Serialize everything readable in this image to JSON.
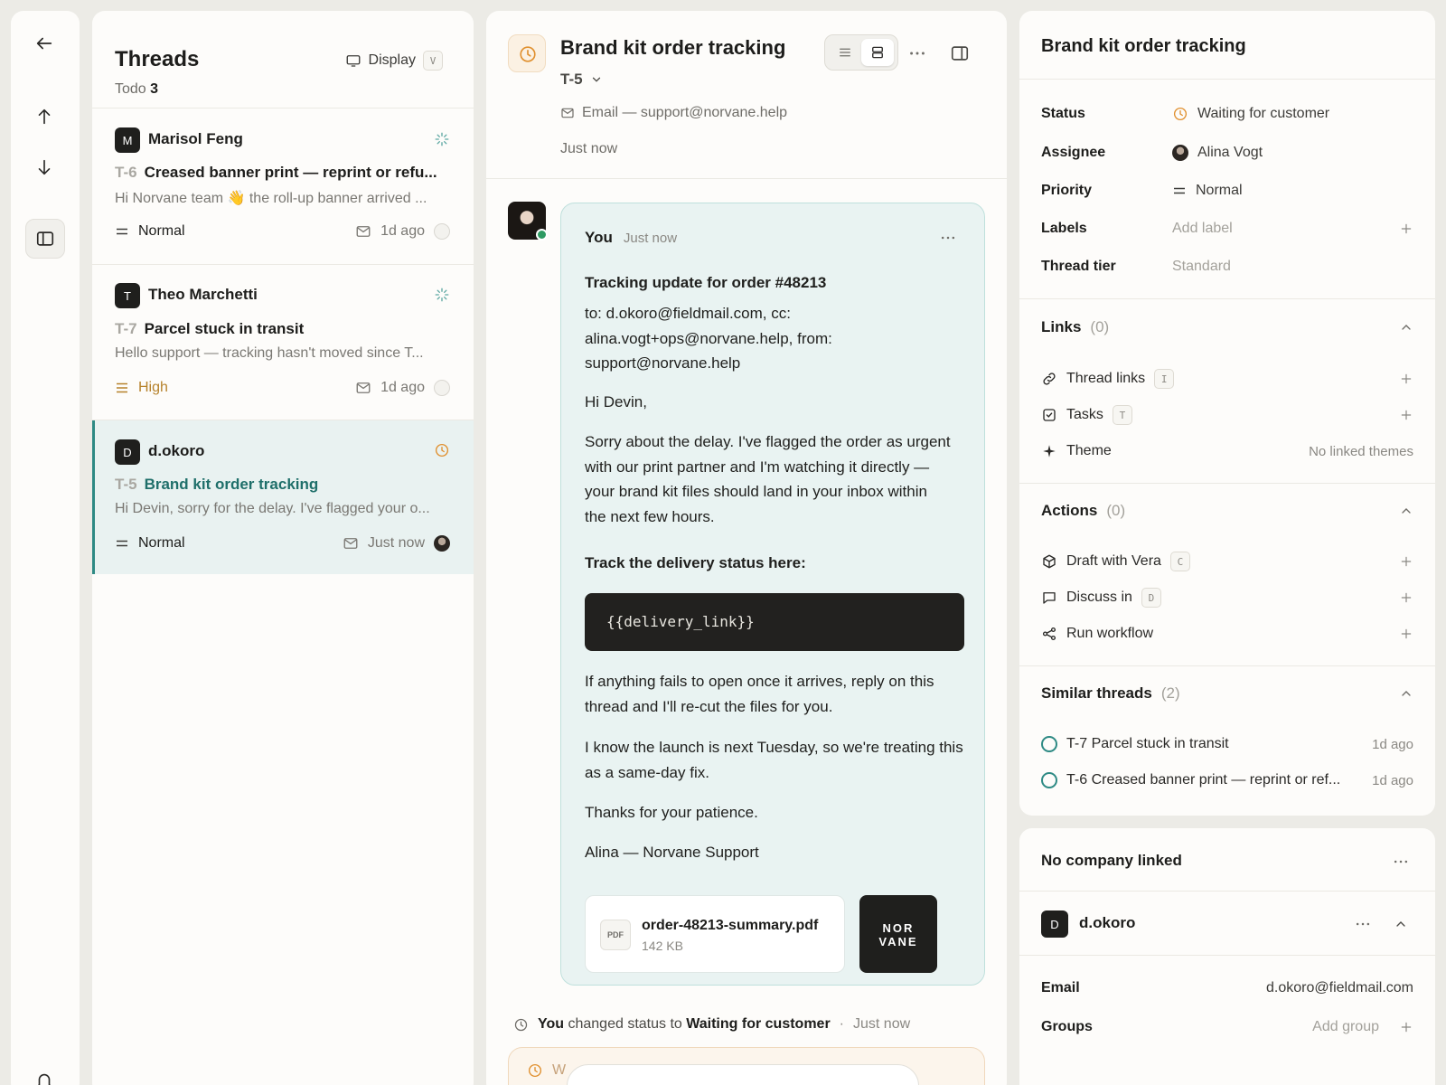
{
  "threads": {
    "title": "Threads",
    "filter_label": "Todo",
    "filter_count": "3",
    "display_label": "Display",
    "display_shortcut": "V",
    "items": [
      {
        "initial": "M",
        "name": "Marisol Feng",
        "id": "T-6",
        "subject": "Creased banner print — reprint or refu...",
        "preview": "Hi Norvane team 👋 the roll-up banner arrived ...",
        "priority": "Normal",
        "time": "1d ago"
      },
      {
        "initial": "T",
        "name": "Theo Marchetti",
        "id": "T-7",
        "subject": "Parcel stuck in transit",
        "preview": "Hello support — tracking hasn't moved since T...",
        "priority": "High",
        "time": "1d ago"
      },
      {
        "initial": "D",
        "name": "d.okoro",
        "id": "T-5",
        "subject": "Brand kit order tracking",
        "preview": "Hi Devin, sorry for the delay. I've flagged your o...",
        "priority": "Normal",
        "time": "Just now"
      }
    ]
  },
  "conversation": {
    "title": "Brand kit order tracking",
    "thread_id": "T-5",
    "channel": "Email — support@norvane.help",
    "updated": "Just now",
    "message": {
      "author": "You",
      "time": "Just now",
      "subject": "Tracking update for order #48213",
      "recipients": "to: d.okoro@fieldmail.com, cc: alina.vogt+ops@norvane.help, from: support@norvane.help",
      "greeting": "Hi Devin,",
      "p1": "Sorry about the delay. I've flagged the order as urgent with our print partner and I'm watching it directly — your brand kit files should land in your inbox within the next few hours.",
      "track_heading": "Track the delivery status here:",
      "code": "{{delivery_link}}",
      "p2": "If anything fails to open once it arrives, reply on this thread and I'll re-cut the files for you.",
      "p3": "I know the launch is next Tuesday, so we're treating this as a same-day fix.",
      "p4": "Thanks for your patience.",
      "signature": "Alina — Norvane Support",
      "attachment": {
        "badge": "PDF",
        "name": "order-48213-summary.pdf",
        "size": "142 KB"
      },
      "logo_line1": "NOR",
      "logo_line2": "VANE"
    },
    "event": {
      "actor": "You",
      "verb": "changed status to",
      "status": "Waiting for customer",
      "sep": "·",
      "time": "Just now"
    },
    "compose_hint": "W"
  },
  "details": {
    "title": "Brand kit order tracking",
    "props": {
      "status_k": "Status",
      "status_v": "Waiting for customer",
      "assignee_k": "Assignee",
      "assignee_v": "Alina Vogt",
      "priority_k": "Priority",
      "priority_v": "Normal",
      "labels_k": "Labels",
      "labels_v": "Add label",
      "tier_k": "Thread tier",
      "tier_v": "Standard"
    },
    "links": {
      "title": "Links",
      "count": "(0)",
      "items": [
        {
          "label": "Thread links",
          "key": "I"
        },
        {
          "label": "Tasks",
          "key": "T"
        },
        {
          "label": "Theme",
          "value": "No linked themes"
        }
      ]
    },
    "actions": {
      "title": "Actions",
      "count": "(0)",
      "items": [
        {
          "label": "Draft with Vera",
          "key": "C"
        },
        {
          "label": "Discuss in",
          "key": "D"
        },
        {
          "label": "Run workflow"
        }
      ]
    },
    "similar": {
      "title": "Similar threads",
      "count": "(2)",
      "items": [
        {
          "label": "T-7 Parcel stuck in transit",
          "time": "1d ago"
        },
        {
          "label": "T-6 Creased banner print — reprint or ref...",
          "time": "1d ago"
        }
      ]
    }
  },
  "company": {
    "title": "No company linked",
    "contact_initial": "D",
    "contact_name": "d.okoro",
    "email_k": "Email",
    "email_v": "d.okoro@fieldmail.com",
    "groups_k": "Groups",
    "groups_v": "Add group"
  },
  "colors": {
    "accent_teal": "#2e8a84",
    "status_orange": "#e0902f",
    "priority_high": "#b6822b",
    "selected_bg": "#e9f2f1"
  }
}
